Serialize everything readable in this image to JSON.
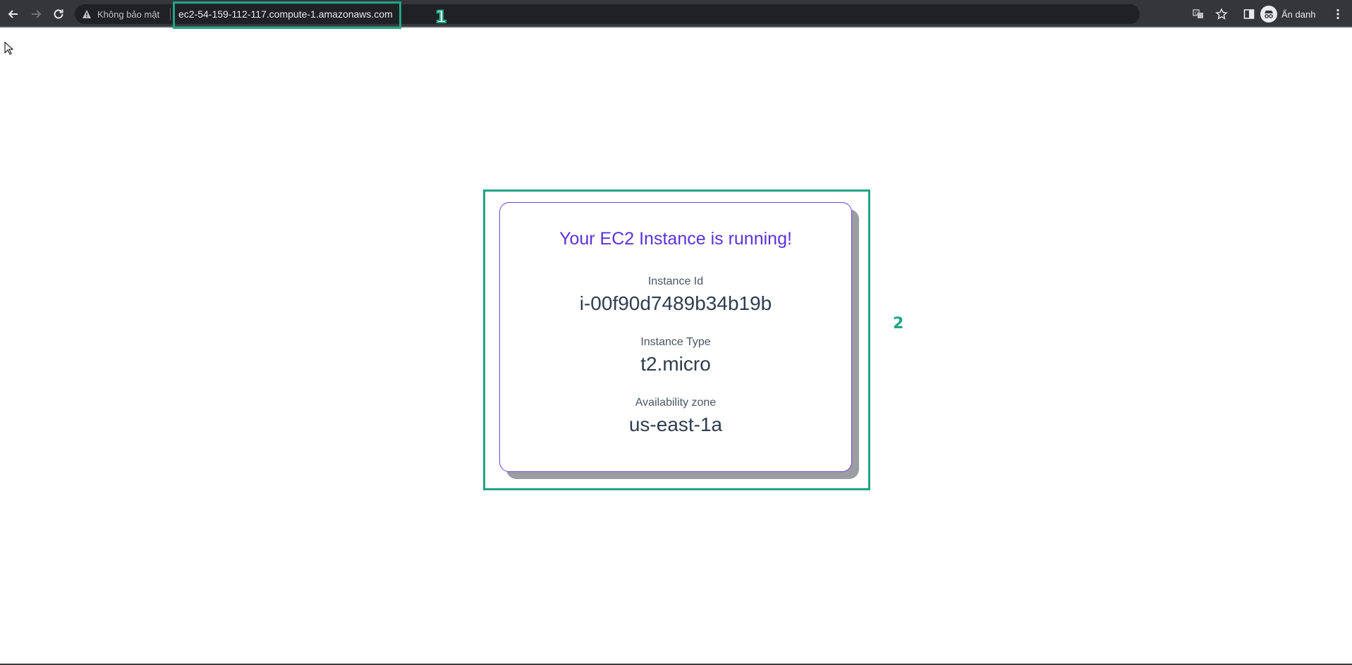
{
  "browser": {
    "security_label": "Không bảo mật",
    "url": "ec2-54-159-112-117.compute-1.amazonaws.com",
    "profile_label": "Ẩn danh"
  },
  "annotations": {
    "marker_1": "1",
    "marker_2": "2",
    "color": "#1ea584"
  },
  "card": {
    "title": "Your EC2 Instance is running!",
    "instance_id_label": "Instance Id",
    "instance_id_value": "i-00f90d7489b34b19b",
    "instance_type_label": "Instance Type",
    "instance_type_value": "t2.micro",
    "az_label": "Availability zone",
    "az_value": "us-east-1a",
    "accent_color": "#5a32dc"
  },
  "icons": {
    "back": "arrow-left-icon",
    "forward": "arrow-right-icon",
    "reload": "reload-icon",
    "warning": "warning-icon",
    "translate": "translate-icon",
    "bookmark": "star-icon",
    "side_panel": "side-panel-icon",
    "incognito": "incognito-icon",
    "menu": "kebab-menu-icon"
  }
}
